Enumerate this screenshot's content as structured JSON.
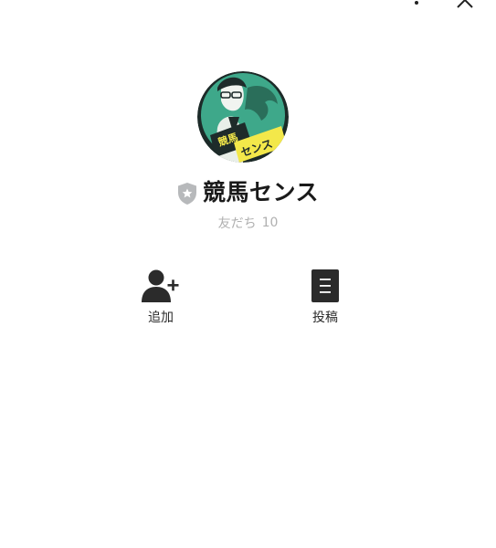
{
  "header": {
    "more_icon": "more-dots-icon",
    "close_icon": "close-icon"
  },
  "profile": {
    "avatar_icon": "account-avatar",
    "badge_icon": "verified-shield-star-icon",
    "name": "競馬センス",
    "friends_label": "友だち",
    "friends_count": "10",
    "colors": {
      "avatar_green": "#3ea88a",
      "avatar_yellow": "#f3e84a",
      "badge_gray": "#b7b9bb",
      "friends_text": "#b0b0b0"
    }
  },
  "actions": {
    "add": {
      "label": "追加",
      "icon": "add-friend-icon"
    },
    "post": {
      "label": "投稿",
      "icon": "post-document-icon"
    }
  }
}
